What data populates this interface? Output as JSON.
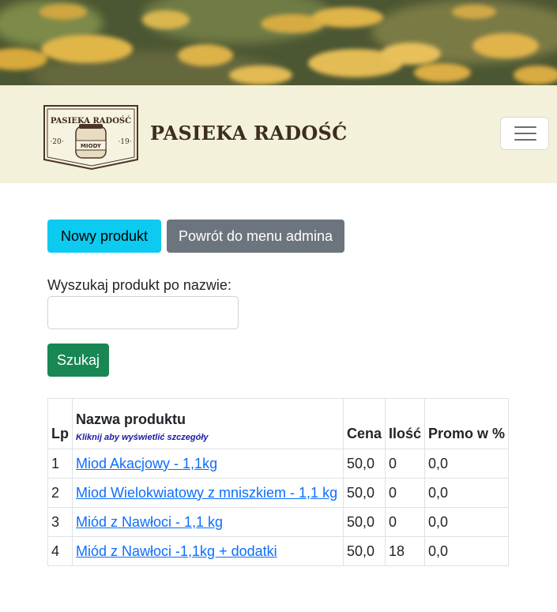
{
  "header": {
    "brand": "PASIEKA RADOŚĆ",
    "logo": {
      "top_text": "PASIEKA RADOŚĆ",
      "year_left": "·20·",
      "year_right": "·19·",
      "jar_label": "MIODY"
    },
    "menu_icon": "hamburger-icon"
  },
  "actions": {
    "new_product": "Nowy produkt",
    "back_to_admin": "Powrót do menu admina"
  },
  "search": {
    "label": "Wyszukaj produkt po nazwie:",
    "value": "",
    "placeholder": "",
    "button": "Szukaj"
  },
  "table": {
    "headers": {
      "lp": "Lp",
      "name": "Nazwa produktu",
      "name_hint": "Kliknij aby wyświetlić szczegóły",
      "price": "Cena",
      "qty": "Ilość",
      "promo": "Promo w %"
    },
    "rows": [
      {
        "lp": "1",
        "name": "Miod Akacjowy - 1,1kg",
        "price": "50,0",
        "qty": "0",
        "promo": "0,0"
      },
      {
        "lp": "2",
        "name": "Miod Wielokwiatowy z mniszkiem - 1,1 kg",
        "price": "50,0",
        "qty": "0",
        "promo": "0,0"
      },
      {
        "lp": "3",
        "name": "Miód z Nawłoci - 1,1 kg",
        "price": "50,0",
        "qty": "0",
        "promo": "0,0"
      },
      {
        "lp": "4",
        "name": "Miód z Nawłoci -1,1kg + dodatki",
        "price": "50,0",
        "qty": "18",
        "promo": "0,0"
      }
    ]
  },
  "colors": {
    "navbar_bg": "#f3f1d9",
    "brand_text": "#3d2c1f",
    "btn_info": "#0dcaf0",
    "btn_secondary": "#6c757d",
    "btn_success": "#198754",
    "link": "#0d6efd"
  }
}
